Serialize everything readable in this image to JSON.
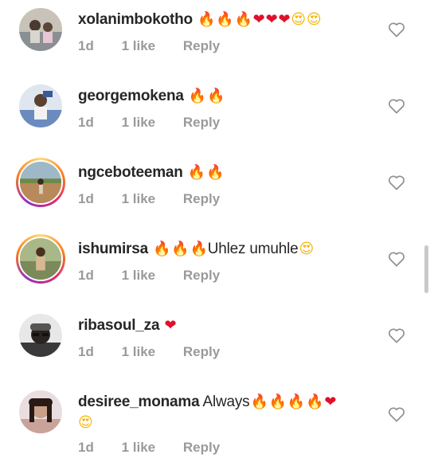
{
  "comments": [
    {
      "username": "xolanimbokotho",
      "text": "",
      "emojis": [
        "🔥",
        "🔥",
        "🔥",
        "❤",
        "❤",
        "❤",
        "😍",
        "😍"
      ],
      "time": "1d",
      "likes": "1 like",
      "reply": "Reply",
      "has_story": false,
      "avatar_color": "#8a8f94"
    },
    {
      "username": "georgemokena",
      "text": "",
      "emojis": [
        "🔥",
        "🔥"
      ],
      "time": "1d",
      "likes": "1 like",
      "reply": "Reply",
      "has_story": false,
      "avatar_color": "#6b8bbf"
    },
    {
      "username": "ngceboteeman",
      "text": "",
      "emojis": [
        "🔥",
        "🔥"
      ],
      "time": "1d",
      "likes": "1 like",
      "reply": "Reply",
      "has_story": true,
      "avatar_color": "#b8895a"
    },
    {
      "username": "ishumirsa",
      "text": "Uhlez umuhle",
      "emojis_before": [
        "🔥",
        "🔥",
        "🔥"
      ],
      "emojis": [
        "😍"
      ],
      "time": "1d",
      "likes": "1 like",
      "reply": "Reply",
      "has_story": true,
      "avatar_color": "#7a8a5a"
    },
    {
      "username": "ribasoul_za",
      "text": "",
      "emojis": [
        "❤"
      ],
      "time": "1d",
      "likes": "1 like",
      "reply": "Reply",
      "has_story": false,
      "avatar_color": "#3a3a3a"
    },
    {
      "username": "desiree_monama",
      "text": "Always",
      "emojis": [
        "🔥",
        "🔥",
        "🔥",
        "🔥",
        "❤",
        "😍"
      ],
      "time": "1d",
      "likes": "1 like",
      "reply": "Reply",
      "has_story": false,
      "avatar_color": "#c9a39a"
    }
  ]
}
